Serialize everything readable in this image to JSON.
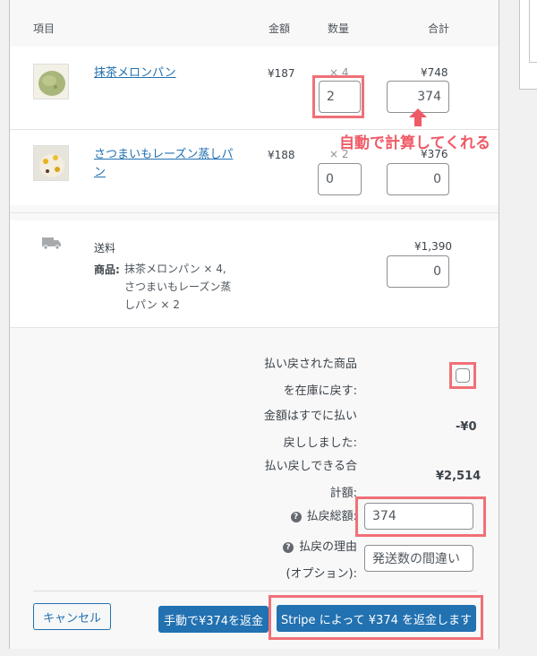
{
  "table_header": {
    "item": "項目",
    "amount": "金額",
    "quantity": "数量",
    "total": "合計"
  },
  "items": [
    {
      "name": "抹茶メロンパン",
      "price": "¥187",
      "qty": "× 4",
      "total": "¥748",
      "refund_qty": "2",
      "refund_total": "374",
      "thumb_icon": "matcha-melon-bread-icon"
    },
    {
      "name_line1": "さつまいもレーズン蒸しパ",
      "name_line2": "ン",
      "price": "¥188",
      "qty": "× 2",
      "total": "¥376",
      "refund_qty": "0",
      "refund_total": "0",
      "thumb_icon": "sweet-potato-bun-icon"
    }
  ],
  "shipping": {
    "title": "送料",
    "products_label": "商品:",
    "products_line1": "抹茶メロンパン × 4,",
    "products_line2": "さつまいもレーズン蒸",
    "products_line3": "しパン × 2",
    "total": "¥1,390",
    "refund_total": "0"
  },
  "annotation": "自動で計算してくれる",
  "refund": {
    "restock_line1": "払い戻された商品",
    "restock_line2": "を在庫に戻す:",
    "already_line1": "金額はすでに払い",
    "already_line2": "戻ししました:",
    "already_value": "-¥0",
    "available_line1": "払い戻しできる合",
    "available_line2": "計額:",
    "available_value": "¥2,514",
    "amount_label": "払戻総額:",
    "amount_value": "374",
    "reason_line1": "払戻の理由",
    "reason_line2": "(オプション):",
    "reason_value": "発送数の間違い"
  },
  "buttons": {
    "cancel": "キャンセル",
    "manual": "手動で¥374を返金",
    "stripe": "Stripe によって ¥374 を返金します"
  },
  "colors": {
    "accent": "#2271b1",
    "highlight": "#f07077"
  }
}
